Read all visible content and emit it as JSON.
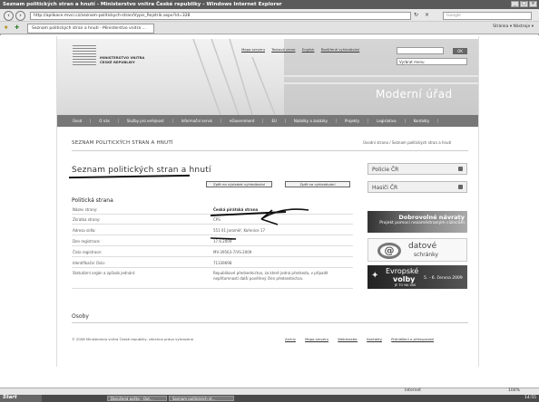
{
  "window": {
    "title": "Seznam politických stran a hnutí - Ministerstvo vnitra České republiky - Windows Internet Explorer",
    "address": "http://aplikace.mvcr.cz/seznam-politickych-stran/Vypis_Rejstrik.aspx?id=328",
    "search_placeholder": "Google",
    "tab_label": "Seznam politických stran a hnutí - Ministerstvo vnitra ...",
    "tools_label": "Stránka ▾  Nástroje ▾"
  },
  "header": {
    "logo_line1": "MINISTERSTVO VNITRA",
    "logo_line2": "ČESKÉ REPUBLIKY",
    "top_links": [
      "Mapa serveru",
      "Textová verze",
      "English",
      "Rozšířené vyhledávání"
    ],
    "select_value": "Vyrbrat menu",
    "ok_label": "OK",
    "tagline": "Moderní úřad"
  },
  "menu": [
    "Úvod",
    "O nás",
    "Služby pro veřejnost",
    "Informační servis",
    "eGovernment",
    "EU",
    "Nabídky a zakázky",
    "Projekty",
    "Legislativa",
    "Kontakty"
  ],
  "content": {
    "section_heading": "SEZNAM POLITICKÝCH STRAN A HNUTÍ",
    "breadcrumb": "Úvodní strana  /  Seznam politických stran a hnutí",
    "title": "Seznam politických stran a hnutí",
    "btn_back_results": "Zpět na výsledek vyhledávání",
    "btn_back_search": "Zpět na vyhledávání",
    "group_heading": "Politická strana",
    "rows": [
      {
        "label": "Název strany:",
        "value": "Česká pirátská strana"
      },
      {
        "label": "Zkratka strany:",
        "value": "ČPS"
      },
      {
        "label": "Adresa sídla:",
        "value": "551 01 Jaroměř, Kořenice 17"
      },
      {
        "label": "Den registrace:",
        "value": "17.6.2009"
      },
      {
        "label": "Číslo registrace:",
        "value": "MV-39563-7/VS-2009"
      },
      {
        "label": "Identifikační číslo:",
        "value": "71339698"
      },
      {
        "label": "Statutární orgán a způsob jednání:",
        "value": "Republikové předsednictvo, za které jedná předseda, v případě nepřítomnosti další pověřený člen předsednictva."
      }
    ],
    "persons_heading": "Osoby"
  },
  "sidebar": {
    "box1": "Policie ČR",
    "box2": "Hasiči ČR",
    "ad1_title": "Dobrovolné návraty",
    "ad1_sub": "Projekt pomoci nezaměstnaným cizincům",
    "ad2_t1": "datové",
    "ad2_t2": "schránky",
    "ad3_t1": "Evropské",
    "ad3_t2": "volby",
    "ad3_t3": "5. - 6. června 2009",
    "ad3_t4": "JE TO NA VÁS"
  },
  "footer": {
    "copyright": "© 2008 Ministerstvo vnitra České republiky, všechna práva vyhrazena",
    "links": [
      "Archiv",
      "Mapa serveru",
      "Webmaster",
      "Kontakty",
      "Prohlášení o přístupnosti"
    ]
  },
  "status": {
    "zone": "Internet",
    "zoom": "100%"
  },
  "taskbar": {
    "start": "Start",
    "tasks": [
      "Doručená pošta - Out...",
      "Seznam politických st..."
    ],
    "clock": "14:55"
  }
}
